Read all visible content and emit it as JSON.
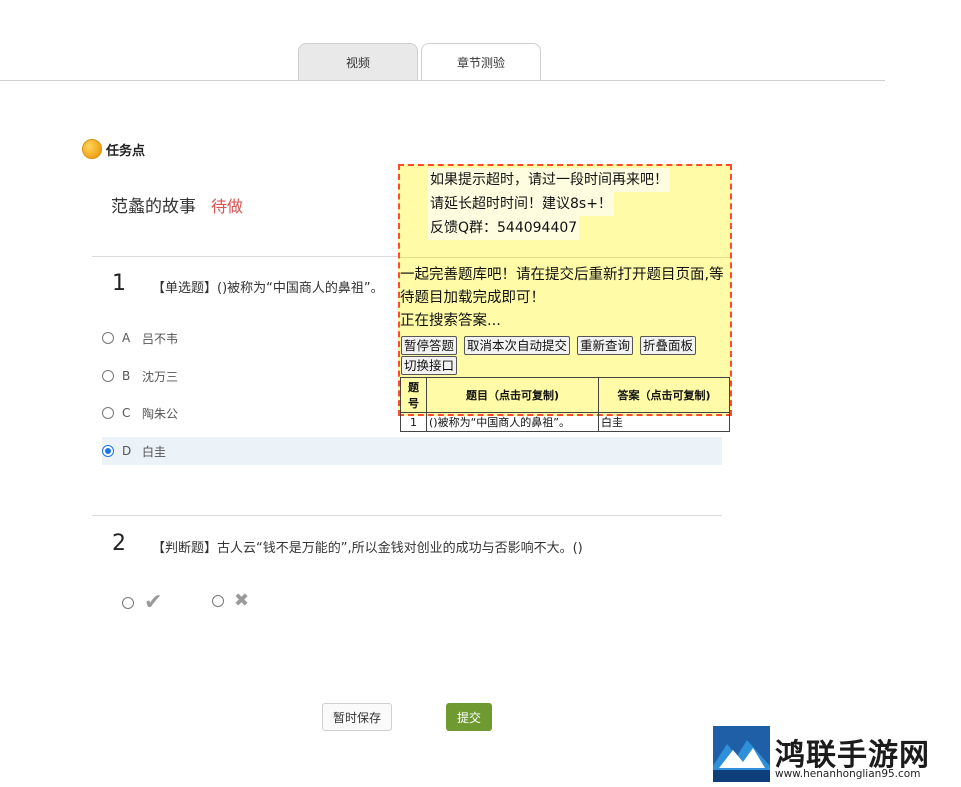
{
  "tabs": [
    {
      "label": "视频",
      "active": false
    },
    {
      "label": "章节测验",
      "active": true
    }
  ],
  "task": {
    "label": "任务点",
    "title": "范蠡的故事",
    "status": "待做"
  },
  "questions": [
    {
      "number": "1",
      "text": "【单选题】()被称为“中国商人的鼻祖”。",
      "options": [
        {
          "letter": "A",
          "text": "吕不韦"
        },
        {
          "letter": "B",
          "text": "沈万三"
        },
        {
          "letter": "C",
          "text": "陶朱公"
        },
        {
          "letter": "D",
          "text": "白圭"
        }
      ],
      "selected": "D"
    },
    {
      "number": "2",
      "text": "【判断题】古人云“钱不是万能的”,所以金钱对创业的成功与否影响不大。()",
      "judge": {
        "true_glyph": "✔",
        "false_glyph": "✖"
      }
    }
  ],
  "actions": {
    "save_label": "暂时保存",
    "submit_label": "提交"
  },
  "panel": {
    "notes": [
      "如果提示超时，请过一段时间再来吧！",
      "请延长超时时间！建议8s+！",
      "反馈Q群：544094407"
    ],
    "message": "一起完善题库吧！请在提交后重新打开题目页面,等待题目加载完成即可！",
    "status": "正在搜索答案...",
    "buttons": [
      "暂停答题",
      "取消本次自动提交",
      "重新查询",
      "折叠面板",
      "切换接口"
    ],
    "table": {
      "headers": [
        "题号",
        "题目（点击可复制)",
        "答案（点击可复制)"
      ],
      "rows": [
        [
          "1",
          "()被称为“中国商人的鼻祖”。",
          "白圭"
        ]
      ]
    }
  },
  "watermark": {
    "title": "鸿联手游网",
    "url": "www.henanhonglian95.com"
  },
  "colors": {
    "status_red": "#d9534f",
    "submit_green": "#6f9a32",
    "panel_bg": "#fffba6",
    "panel_border": "#ff4b2b",
    "radio_blue": "#1a73e8"
  }
}
